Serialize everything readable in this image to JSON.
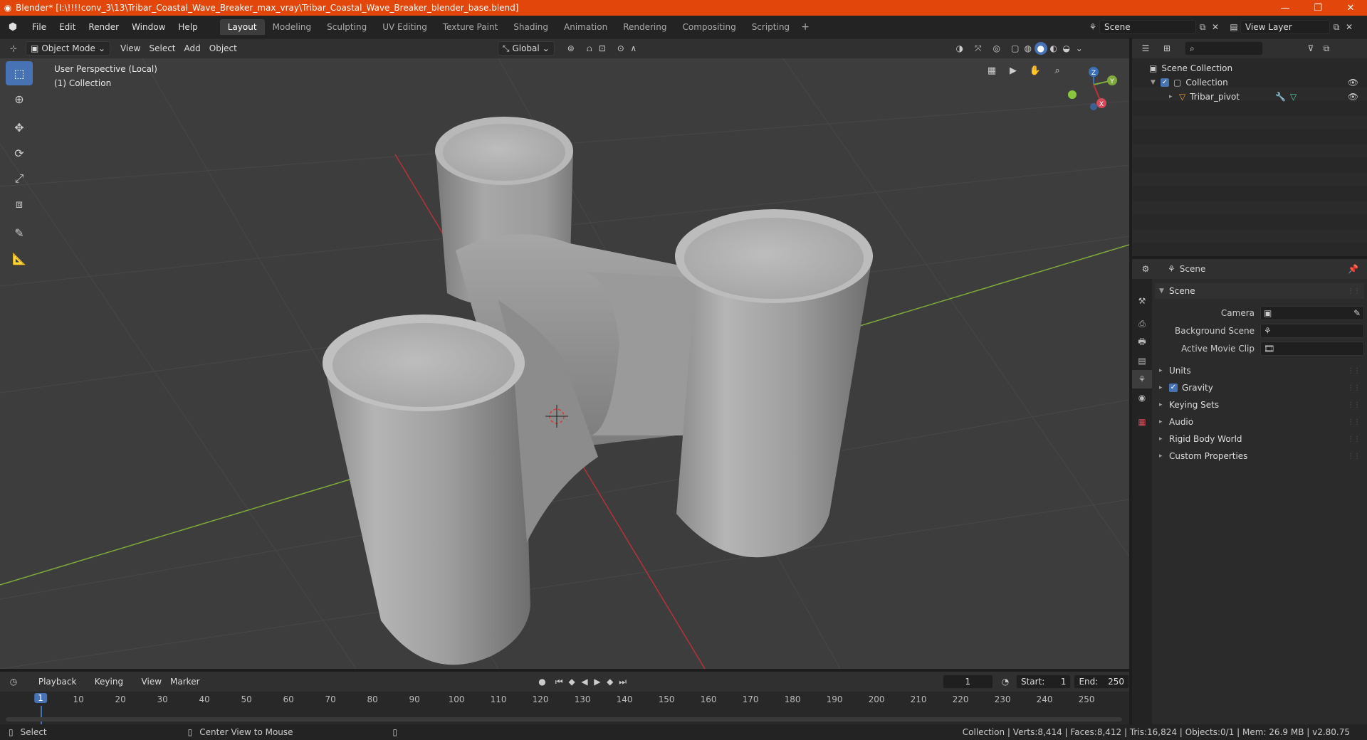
{
  "window": {
    "title": "Blender* [I:\\!!!!conv_3\\13\\Tribar_Coastal_Wave_Breaker_max_vray\\Tribar_Coastal_Wave_Breaker_blender_base.blend]",
    "minimize": "—",
    "maximize": "❐",
    "close": "✕"
  },
  "menu": [
    "File",
    "Edit",
    "Render",
    "Window",
    "Help"
  ],
  "workspaces": [
    "Layout",
    "Modeling",
    "Sculpting",
    "UV Editing",
    "Texture Paint",
    "Shading",
    "Animation",
    "Rendering",
    "Compositing",
    "Scripting"
  ],
  "active_workspace": "Layout",
  "scene_selector": "Scene",
  "view_layer_selector": "View Layer",
  "viewport_header": {
    "mode": "Object Mode",
    "menus": [
      "View",
      "Select",
      "Add",
      "Object"
    ],
    "orientation": "Global"
  },
  "viewport": {
    "perspective_label": "User Perspective (Local)",
    "collection_label": "(1) Collection",
    "gizmo_axes": {
      "x": "X",
      "y": "Y",
      "z": "Z"
    }
  },
  "tools": [
    "select-box",
    "cursor",
    "move",
    "rotate",
    "scale",
    "transform",
    "annotate",
    "measure"
  ],
  "timeline_header": {
    "menus": [
      "Playback",
      "Keying",
      "View",
      "Marker"
    ],
    "current_frame": "1",
    "start_label": "Start:",
    "start_value": "1",
    "end_label": "End:",
    "end_value": "250"
  },
  "timeline": {
    "current": "1",
    "ticks": [
      "10",
      "20",
      "30",
      "40",
      "50",
      "60",
      "70",
      "80",
      "90",
      "100",
      "110",
      "120",
      "130",
      "140",
      "150",
      "160",
      "170",
      "180",
      "190",
      "200",
      "210",
      "220",
      "230",
      "240",
      "250"
    ]
  },
  "statusbar": {
    "select": "Select",
    "center_view": "Center View to Mouse",
    "stats": "Collection | Verts:8,414 | Faces:8,412 | Tris:16,824 | Objects:0/1 | Mem: 26.9 MB | v2.80.75"
  },
  "outliner": {
    "root": "Scene Collection",
    "collection": "Collection",
    "object": "Tribar_pivot"
  },
  "properties": {
    "header": "Scene",
    "panel_scene": "Scene",
    "camera_label": "Camera",
    "background_scene_label": "Background Scene",
    "active_movie_clip_label": "Active Movie Clip",
    "panels": [
      "Units",
      "Gravity",
      "Keying Sets",
      "Audio",
      "Rigid Body World",
      "Custom Properties"
    ]
  },
  "colors": {
    "titlebar": "#e2460b",
    "accent": "#4772b3",
    "axis_x": "#b5323c",
    "axis_y": "#7fa93a"
  }
}
